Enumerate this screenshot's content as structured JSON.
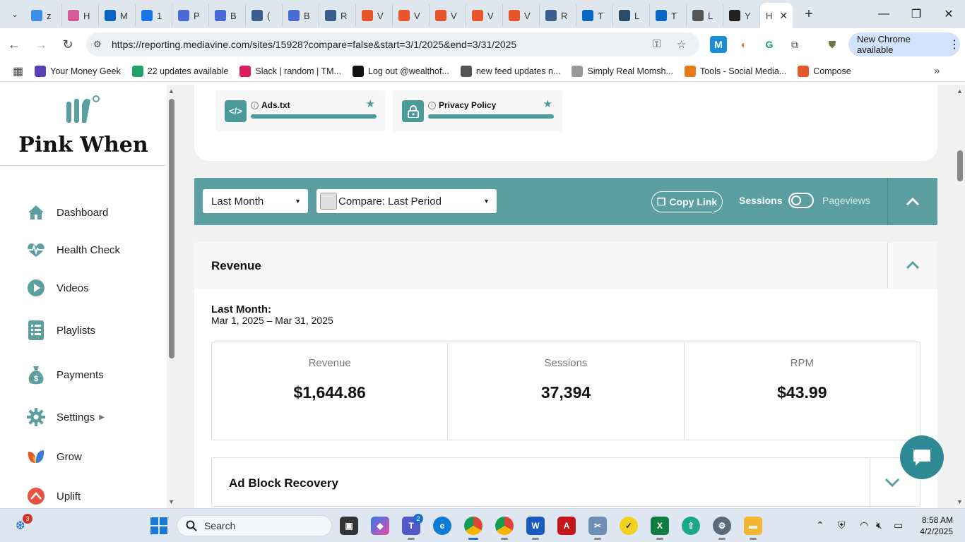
{
  "browser": {
    "tabs": [
      {
        "label": "z",
        "color": "#3c8ee6"
      },
      {
        "label": "H",
        "color": "#d65b9b"
      },
      {
        "label": "M",
        "color": "#0a64c4"
      },
      {
        "label": "1",
        "color": "#1a73e8"
      },
      {
        "label": "P",
        "color": "#4a6cd4"
      },
      {
        "label": "B",
        "color": "#4a6cd4"
      },
      {
        "label": "(",
        "color": "#3a5f8f"
      },
      {
        "label": "B",
        "color": "#4a6cd4"
      },
      {
        "label": "R",
        "color": "#3a5f8f"
      },
      {
        "label": "V",
        "color": "#e8572b"
      },
      {
        "label": "V",
        "color": "#e8572b"
      },
      {
        "label": "V",
        "color": "#e8572b"
      },
      {
        "label": "V",
        "color": "#e8572b"
      },
      {
        "label": "V",
        "color": "#e8572b"
      },
      {
        "label": "R",
        "color": "#3a5f8f"
      },
      {
        "label": "T",
        "color": "#0a66c2"
      },
      {
        "label": "L",
        "color": "#2a4b6a"
      },
      {
        "label": "T",
        "color": "#0a66c2"
      },
      {
        "label": "L",
        "color": "#555"
      },
      {
        "label": "Y",
        "color": "#222"
      }
    ],
    "active_tab": {
      "label": "H"
    },
    "url": "https://reporting.mediavine.com/sites/15928?compare=false&start=3/1/2025&end=3/31/2025",
    "update_button": "New Chrome available",
    "bookmarks": [
      {
        "label": "Your Money Geek",
        "color": "#5a3fb8"
      },
      {
        "label": "22 updates available",
        "color": "#21a366"
      },
      {
        "label": "Slack | random | TM...",
        "color": "#e01e5a"
      },
      {
        "label": "Log out @wealthof...",
        "color": "#111"
      },
      {
        "label": "new feed updates n...",
        "color": "#555"
      },
      {
        "label": "Simply Real Momsh...",
        "color": "#999"
      },
      {
        "label": "Tools - Social Media...",
        "color": "#e87a1a"
      },
      {
        "label": "Compose",
        "color": "#e8572b"
      }
    ]
  },
  "sidebar": {
    "site_name": "Pink When",
    "items": [
      {
        "label": "Dashboard",
        "icon": "home-icon"
      },
      {
        "label": "Health Check",
        "icon": "heartbeat-icon"
      },
      {
        "label": "Videos",
        "icon": "play-icon"
      },
      {
        "label": "Playlists",
        "icon": "playlist-icon"
      },
      {
        "label": "Payments",
        "icon": "money-bag-icon"
      },
      {
        "label": "Settings",
        "icon": "gear-icon"
      },
      {
        "label": "Grow",
        "icon": "grow-icon"
      },
      {
        "label": "Uplift",
        "icon": "uplift-icon"
      }
    ]
  },
  "health_cards": [
    {
      "label": "Ads.txt",
      "icon": "code-icon"
    },
    {
      "label": "Privacy Policy",
      "icon": "lock-icon"
    }
  ],
  "filters": {
    "period": "Last Month",
    "compare": "Compare: Last Period",
    "copy_link": "Copy Link",
    "sessions": "Sessions",
    "pageviews": "Pageviews"
  },
  "revenue": {
    "title": "Revenue",
    "period_label": "Last Month:",
    "period_dates": "Mar 1, 2025 – Mar 31, 2025",
    "stats": [
      {
        "label": "Revenue",
        "value": "$1,644.86"
      },
      {
        "label": "Sessions",
        "value": "37,394"
      },
      {
        "label": "RPM",
        "value": "$43.99"
      }
    ]
  },
  "ad_block": {
    "title": "Ad Block Recovery"
  },
  "taskbar": {
    "search": "Search",
    "time": "8:58 AM",
    "date": "4/2/2025",
    "notif_count": "3",
    "teams_badge": "2",
    "accent": "#5b9fa1"
  }
}
